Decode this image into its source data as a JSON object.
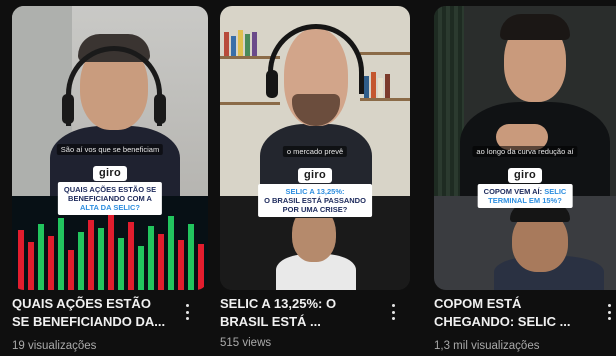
{
  "cards": [
    {
      "caption": "São aí vos que se beneficiam",
      "giro": "giro",
      "headline_lines": [
        "QUAIS AÇÕES ESTÃO SE",
        "BENEFICIANDO COM A"
      ],
      "headline_highlight": "ALTA DA SELIC?",
      "title_lines": [
        "QUAIS AÇÕES ESTÃO",
        "SE BENEFICIANDO DA..."
      ],
      "views": "19 visualizações",
      "more_icon": "kebab-icon"
    },
    {
      "caption": "o mercado prevê",
      "giro": "giro",
      "headline_highlight": "SELIC A 13,25%:",
      "headline_lines": [
        "O BRASIL ESTÁ PASSANDO",
        "POR UMA CRISE?"
      ],
      "title_lines": [
        "SELIC A 13,25%: O",
        "BRASIL ESTÁ ..."
      ],
      "views": "515 views",
      "more_icon": "kebab-icon"
    },
    {
      "caption": "ao longo da curva redução aí",
      "giro": "giro",
      "headline_lines": [
        "COPOM VEM AÍ:"
      ],
      "headline_highlight": "SELIC",
      "headline_highlight2": "TERMINAL EM 15%?",
      "title_lines": [
        "COPOM ESTÁ",
        "CHEGANDO: SELIC ..."
      ],
      "views": "1,3 mil visualizações",
      "more_icon": "kebab-icon"
    }
  ],
  "colors": {
    "background": "#0f0f0f",
    "headline_text": "#1d2a5c",
    "highlight": "#2f8fe0",
    "market_green": "#22c55e",
    "market_red": "#e11d2e"
  }
}
